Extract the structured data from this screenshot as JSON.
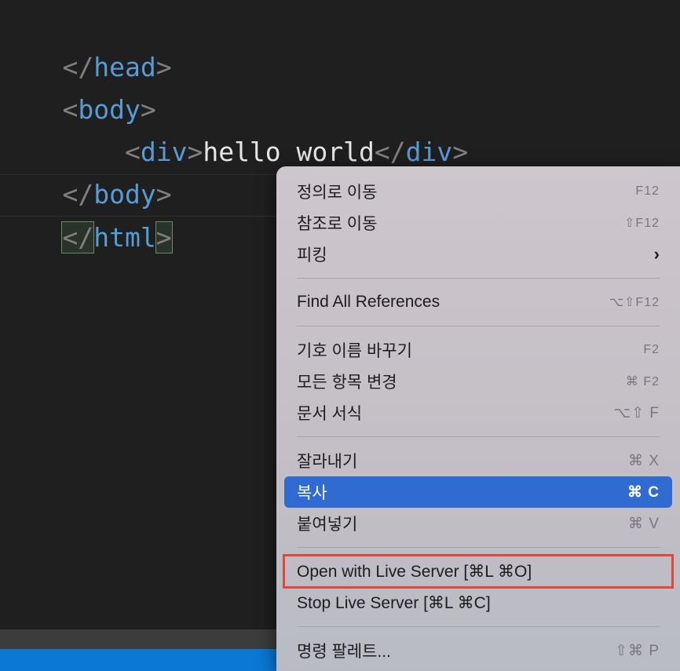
{
  "editor": {
    "lines": [
      {
        "open": "</",
        "tag": "head",
        "close": ">"
      },
      {
        "open": "<",
        "tag": "body",
        "close": ">"
      },
      {
        "indent": "    ",
        "open": "<",
        "tag": "div",
        "close": ">",
        "text": "hello world",
        "open2": "</",
        "tag2": "div",
        "close2": ">"
      },
      {
        "open": "</",
        "tag": "body",
        "close": ">"
      },
      {
        "open": "</",
        "tag": "html",
        "close": ">"
      }
    ]
  },
  "context_menu": {
    "groups": [
      {
        "items": [
          {
            "label": "정의로 이동",
            "shortcut": "F12"
          },
          {
            "label": "참조로 이동",
            "shortcut": "⇧F12"
          },
          {
            "label": "피킹",
            "submenu": "›"
          }
        ]
      },
      {
        "items": [
          {
            "label": "Find All References",
            "shortcut": "⌥⇧F12"
          }
        ]
      },
      {
        "items": [
          {
            "label": "기호 이름 바꾸기",
            "shortcut": "F2"
          },
          {
            "label": "모든 항목 변경",
            "shortcut": "⌘ F2"
          },
          {
            "label": "문서 서식",
            "shortcut": "⌥⇧ F"
          }
        ]
      },
      {
        "items": [
          {
            "label": "잘라내기",
            "shortcut": "⌘ X"
          },
          {
            "label": "복사",
            "shortcut": "⌘ C",
            "state": "selected"
          },
          {
            "label": "붙여넣기",
            "shortcut": "⌘ V"
          }
        ]
      },
      {
        "items": [
          {
            "label": "Open with Live Server [⌘L ⌘O]",
            "state": "highlighted"
          },
          {
            "label": "Stop Live Server [⌘L ⌘C]"
          }
        ]
      },
      {
        "items": [
          {
            "label": "명령 팔레트...",
            "shortcut": "⇧⌘ P"
          }
        ]
      }
    ]
  },
  "colors": {
    "editor_bg": "#1f1f1f",
    "tag": "#569cd6",
    "bracket": "#808080",
    "selection": "#2f6bd1",
    "highlight_border": "#e2483a",
    "status_blue": "#0a78d4"
  }
}
